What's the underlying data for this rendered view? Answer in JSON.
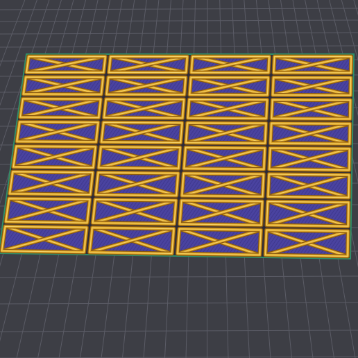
{
  "viewport": {
    "background_color": "#3d3e45",
    "grid_line_color": "#5b5c66",
    "bed_edge_color": "#2f8f6a"
  },
  "print_layer": {
    "rows": 8,
    "columns": 4,
    "panel_fill_color": "#4a43a0",
    "panel_fill_dark_color": "#3a3486",
    "frame_outer_color": "#8a5a10",
    "frame_color": "#e0a82a",
    "frame_highlight_color": "#f5d36a"
  }
}
